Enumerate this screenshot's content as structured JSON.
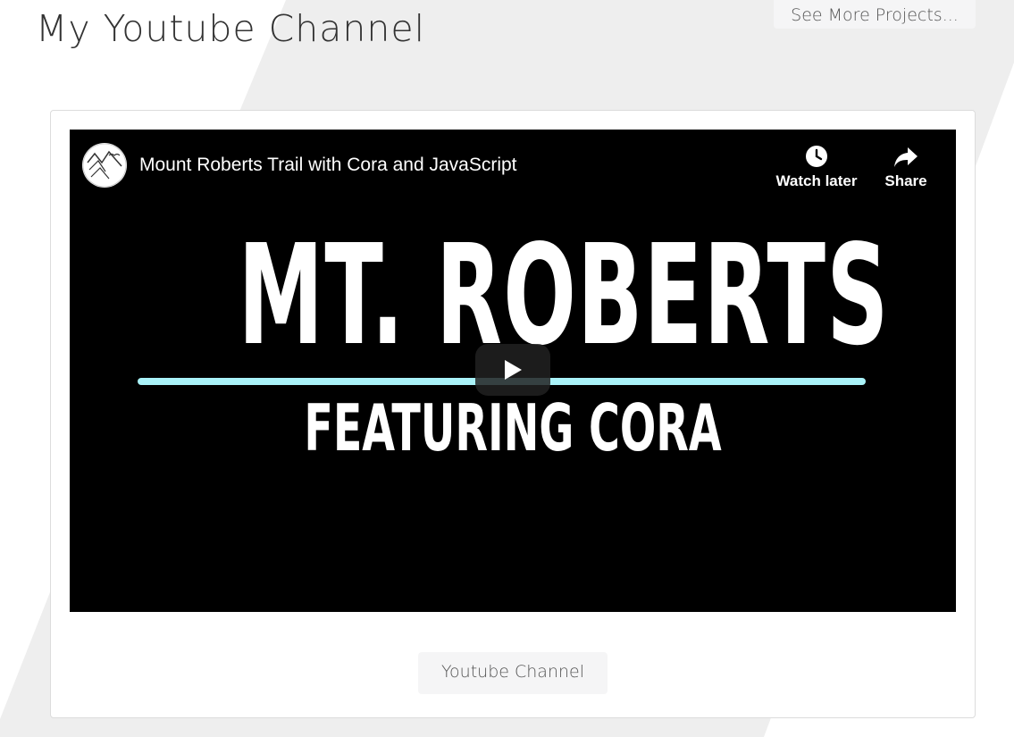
{
  "header": {
    "title": "My Youtube Channel",
    "more_projects_label": "See More Projects..."
  },
  "video": {
    "title": "Mount Roberts Trail with Cora and JavaScript",
    "watch_later_label": "Watch later",
    "share_label": "Share",
    "thumbnail_line1": "MT. ROBERTS",
    "thumbnail_line2": "FEATURING CORA",
    "thumbnail_accent": "#a9f2f8",
    "icons": [
      "channel-avatar",
      "clock-icon",
      "share-arrow-icon",
      "play-icon"
    ]
  },
  "footer": {
    "channel_button_label": "Youtube Channel"
  },
  "colors": {
    "background_band": "#eeeeee",
    "player_background": "#000000",
    "button_background": "#f5f5f6"
  }
}
